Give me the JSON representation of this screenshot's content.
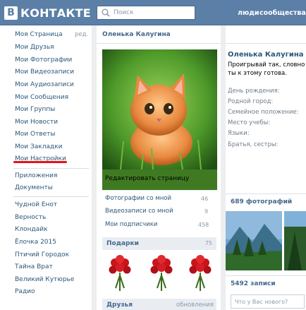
{
  "header": {
    "logo_box": "В",
    "logo_text": "КОНТАКТЕ",
    "search_placeholder": "Поиск",
    "nav_people": "люди",
    "nav_communities": "сообщества"
  },
  "menu": {
    "edit_label": "ред.",
    "group1": [
      "Моя Страница",
      "Мои Друзья",
      "Мои Фотографии",
      "Мои Видеозаписи",
      "Мои Аудиозаписи",
      "Мои Сообщения",
      "Мои Группы",
      "Мои Новости",
      "Мои Ответы",
      "Мои Закладки",
      "Мои Настройки"
    ],
    "group2": [
      "Приложения",
      "Документы"
    ],
    "group3": [
      "Чудной Енот",
      "Верность",
      "Клондайк",
      "Ёлочка 2015",
      "Птичий Городок",
      "Тайна Врат",
      "Великий Кутюрье",
      "Радио"
    ]
  },
  "profile": {
    "header_name": "Оленька Калугина",
    "name": "Оленька Калугина",
    "status": "Проигрывай так, словно ты к этому готова.",
    "fields": [
      "День рождения:",
      "Родной город:",
      "Семейное положение:",
      "Место учебы:",
      "Языки:",
      "Братья, сестры:"
    ],
    "edit_page": "Редактировать страницу"
  },
  "stats": [
    {
      "label": "Фотографии со мной",
      "count": "46"
    },
    {
      "label": "Видеозаписи со мной",
      "count": "9"
    },
    {
      "label": "Мои подписчики",
      "count": "458"
    }
  ],
  "gifts": {
    "title": "Подарки",
    "count": "75"
  },
  "friends": {
    "title": "Друзья",
    "action": "обновления"
  },
  "photos": {
    "title": "689 фотографий"
  },
  "wall": {
    "title": "5492 записи",
    "placeholder": "Что у Вас нового?"
  },
  "colors": {
    "topbar": "#5b7fa6",
    "link": "#2b587a",
    "highlight": "#e4141b"
  }
}
